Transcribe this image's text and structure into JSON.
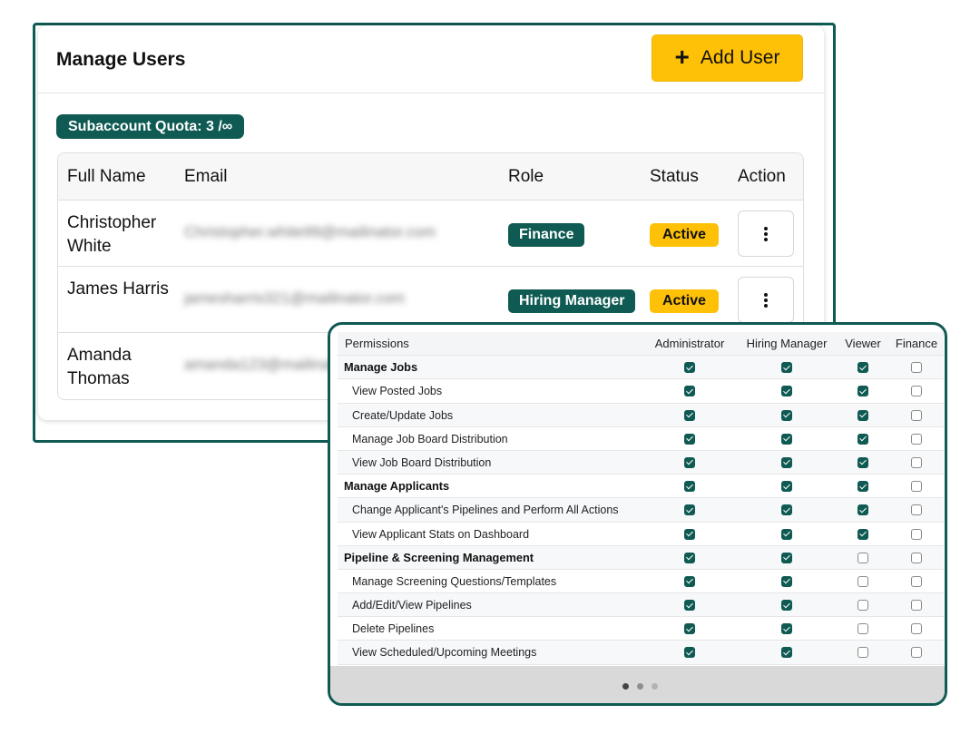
{
  "users_card": {
    "title": "Manage Users",
    "add_user_label": "Add User",
    "quota_label": "Subaccount Quota: 3 /∞",
    "columns": [
      "Full Name",
      "Email",
      "Role",
      "Status",
      "Action"
    ],
    "rows": [
      {
        "name": "Christopher White",
        "email": "Christopher.white99@mailinator.com",
        "role": "Finance",
        "status": "Active"
      },
      {
        "name": "James Harris",
        "email": "jamesharris321@mailinator.com",
        "role": "Hiring Manager",
        "status": "Active"
      },
      {
        "name": "Amanda Thomas",
        "email": "amanda123@mailinator.com",
        "role": "",
        "status": ""
      }
    ]
  },
  "permissions": {
    "columns": [
      "Permissions",
      "Administrator",
      "Hiring Manager",
      "Viewer",
      "Finance"
    ],
    "rows": [
      {
        "label": "Manage Jobs",
        "section": true,
        "values": [
          true,
          true,
          true,
          false
        ]
      },
      {
        "label": "View Posted Jobs",
        "section": false,
        "values": [
          true,
          true,
          true,
          false
        ]
      },
      {
        "label": "Create/Update Jobs",
        "section": false,
        "values": [
          true,
          true,
          true,
          false
        ]
      },
      {
        "label": "Manage Job Board Distribution",
        "section": false,
        "values": [
          true,
          true,
          true,
          false
        ]
      },
      {
        "label": "View Job Board Distribution",
        "section": false,
        "values": [
          true,
          true,
          true,
          false
        ]
      },
      {
        "label": "Manage Applicants",
        "section": true,
        "values": [
          true,
          true,
          true,
          false
        ]
      },
      {
        "label": "Change Applicant's Pipelines and Perform All Actions",
        "section": false,
        "values": [
          true,
          true,
          true,
          false
        ]
      },
      {
        "label": "View Applicant Stats on Dashboard",
        "section": false,
        "values": [
          true,
          true,
          true,
          false
        ]
      },
      {
        "label": "Pipeline & Screening Management",
        "section": true,
        "values": [
          true,
          true,
          false,
          false
        ]
      },
      {
        "label": "Manage Screening Questions/Templates",
        "section": false,
        "values": [
          true,
          true,
          false,
          false
        ]
      },
      {
        "label": "Add/Edit/View Pipelines",
        "section": false,
        "values": [
          true,
          true,
          false,
          false
        ]
      },
      {
        "label": "Delete Pipelines",
        "section": false,
        "values": [
          true,
          true,
          false,
          false
        ]
      },
      {
        "label": "View Scheduled/Upcoming Meetings",
        "section": false,
        "values": [
          true,
          true,
          false,
          false
        ]
      }
    ]
  },
  "pager": {
    "count": 3,
    "active_index": 0
  },
  "colors": {
    "brand": "#0f5a53",
    "accent": "#ffc107"
  },
  "icons": [
    "plus-icon",
    "vertical-dots-icon",
    "checkbox-icon"
  ]
}
